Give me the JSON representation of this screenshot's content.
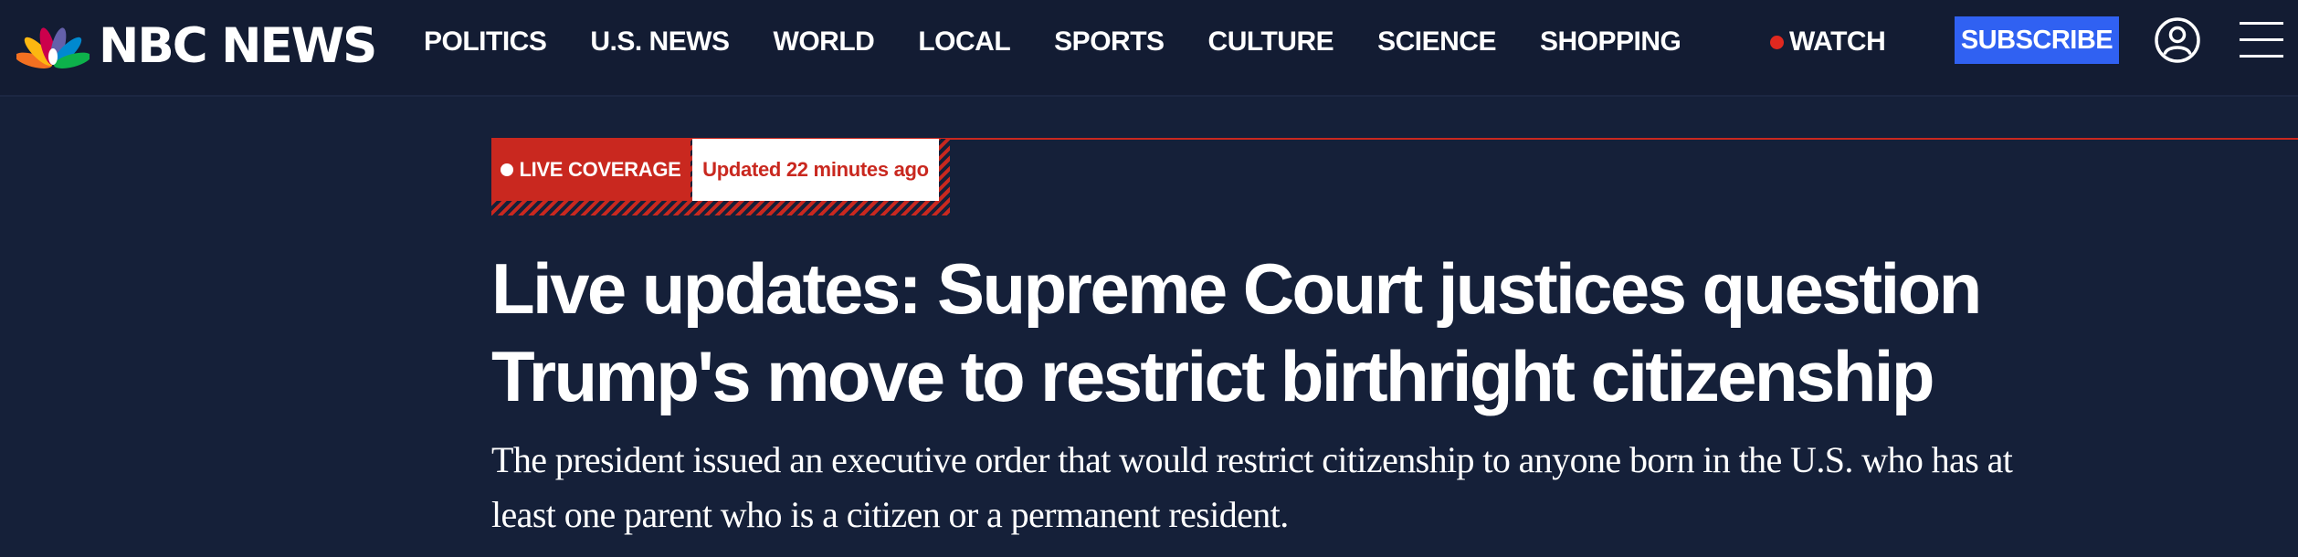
{
  "header": {
    "logo_text": "NBC NEWS",
    "nav": [
      {
        "label": "POLITICS"
      },
      {
        "label": "U.S. NEWS"
      },
      {
        "label": "WORLD"
      },
      {
        "label": "LOCAL"
      },
      {
        "label": "SPORTS"
      },
      {
        "label": "CULTURE"
      },
      {
        "label": "SCIENCE"
      },
      {
        "label": "SHOPPING"
      }
    ],
    "watch_label": "WATCH",
    "subscribe_label": "SUBSCRIBE",
    "icons": {
      "logo": "peacock-logo-icon",
      "account": "user-account-icon",
      "menu": "hamburger-menu-icon"
    }
  },
  "article": {
    "live_badge": "LIVE COVERAGE",
    "updated": "Updated 22 minutes ago",
    "headline_lines": [
      "Live updates: Supreme Court justices question",
      "Trump's move to restrict birthright citizenship"
    ],
    "dek": "The president issued an executive order that would restrict citizenship to anyone born in the U.S. who has at least one parent who is a citizen or a permanent resident."
  },
  "colors": {
    "background": "#152039",
    "header_background": "#131c33",
    "live_red": "#c9281f",
    "subscribe_blue": "#3061f2",
    "text": "#ffffff"
  }
}
